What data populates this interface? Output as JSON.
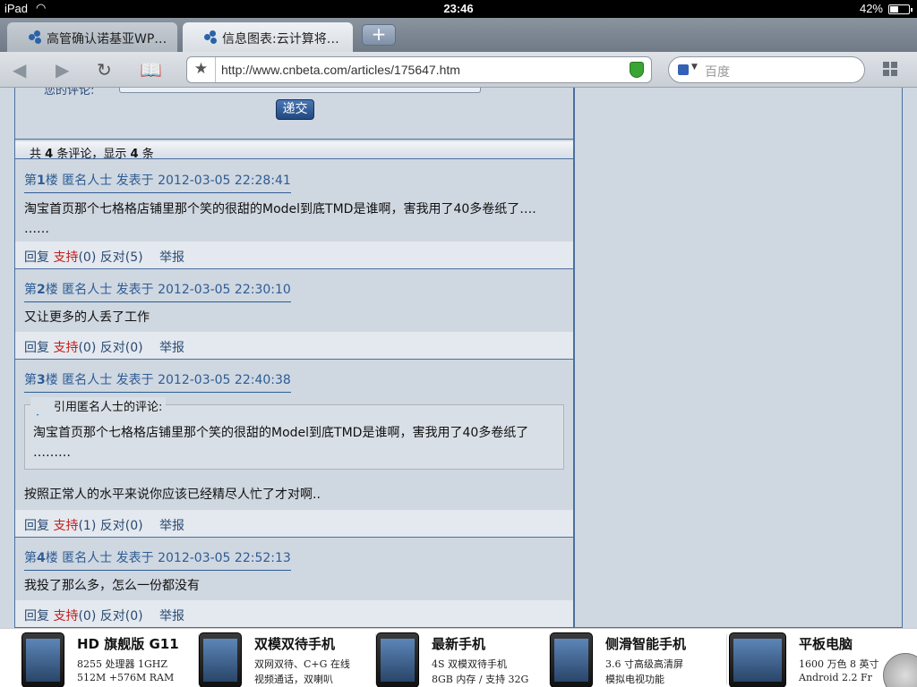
{
  "status": {
    "carrier": "iPad",
    "time": "23:46",
    "battery_pct": "42%"
  },
  "tabs": [
    {
      "title": "高管确认诺基亚WP…"
    },
    {
      "title": "信息图表:云计算将…"
    }
  ],
  "toolbar": {
    "url": "http://www.cnbeta.com/articles/175647.htm",
    "search_placeholder": "百度"
  },
  "form": {
    "label": "您的评论:",
    "submit_label": "递交"
  },
  "summary": {
    "prefix": "共",
    "total": "4",
    "mid": "条评论，显示",
    "shown": "4",
    "suffix": "条"
  },
  "comments": [
    {
      "floor_prefix": "第",
      "floor_num": "1",
      "floor_suffix": "楼",
      "meta": "匿名人士 发表于 2012-03-05 22:28:41",
      "body": "淘宝首页那个七格格店铺里那个笑的很甜的Model到底TMD是谁啊，害我用了40多卷纸了…. ……",
      "reply": "回复",
      "support": "支持",
      "support_count": "(0)",
      "oppose": "反对",
      "oppose_count": "(5)",
      "report": "举报"
    },
    {
      "floor_prefix": "第",
      "floor_num": "2",
      "floor_suffix": "楼",
      "meta": "匿名人士 发表于 2012-03-05 22:30:10",
      "body": "又让更多的人丢了工作",
      "reply": "回复",
      "support": "支持",
      "support_count": "(0)",
      "oppose": "反对",
      "oppose_count": "(0)",
      "report": "举报"
    },
    {
      "floor_prefix": "第",
      "floor_num": "3",
      "floor_suffix": "楼",
      "meta": "匿名人士 发表于 2012-03-05 22:40:38",
      "quote_title": "引用匿名人士的评论:",
      "quote_text": "淘宝首页那个七格格店铺里那个笑的很甜的Model到底TMD是谁啊，害我用了40多卷纸了 ………",
      "body": "按照正常人的水平来说你应该已经精尽人忙了才对啊..",
      "reply": "回复",
      "support": "支持",
      "support_count": "(1)",
      "oppose": "反对",
      "oppose_count": "(0)",
      "report": "举报"
    },
    {
      "floor_prefix": "第",
      "floor_num": "4",
      "floor_suffix": "楼",
      "meta": "匿名人士 发表于 2012-03-05 22:52:13",
      "body": "我投了那么多，怎么一份都没有",
      "reply": "回复",
      "support": "支持",
      "support_count": "(0)",
      "oppose": "反对",
      "oppose_count": "(0)",
      "report": "举报"
    }
  ],
  "ads": [
    {
      "title": "HD 旗舰版 G11",
      "line1": "8255 处理器 1GHZ",
      "line2": "512M +576M RAM"
    },
    {
      "title": "双模双待手机",
      "line1": "双网双待、C+G 在线",
      "line2": "视频通话，双喇叭"
    },
    {
      "title": "最新手机",
      "line1": "4S 双模双待手机",
      "line2": "8GB 内存 / 支持 32G"
    },
    {
      "title": "侧滑智能手机",
      "line1": "3.6 寸高级高清屏",
      "line2": "模拟电视功能"
    },
    {
      "title": "平板电脑",
      "line1": "1600 万色 8 英寸",
      "line2": "Android 2.2 Fr"
    }
  ]
}
